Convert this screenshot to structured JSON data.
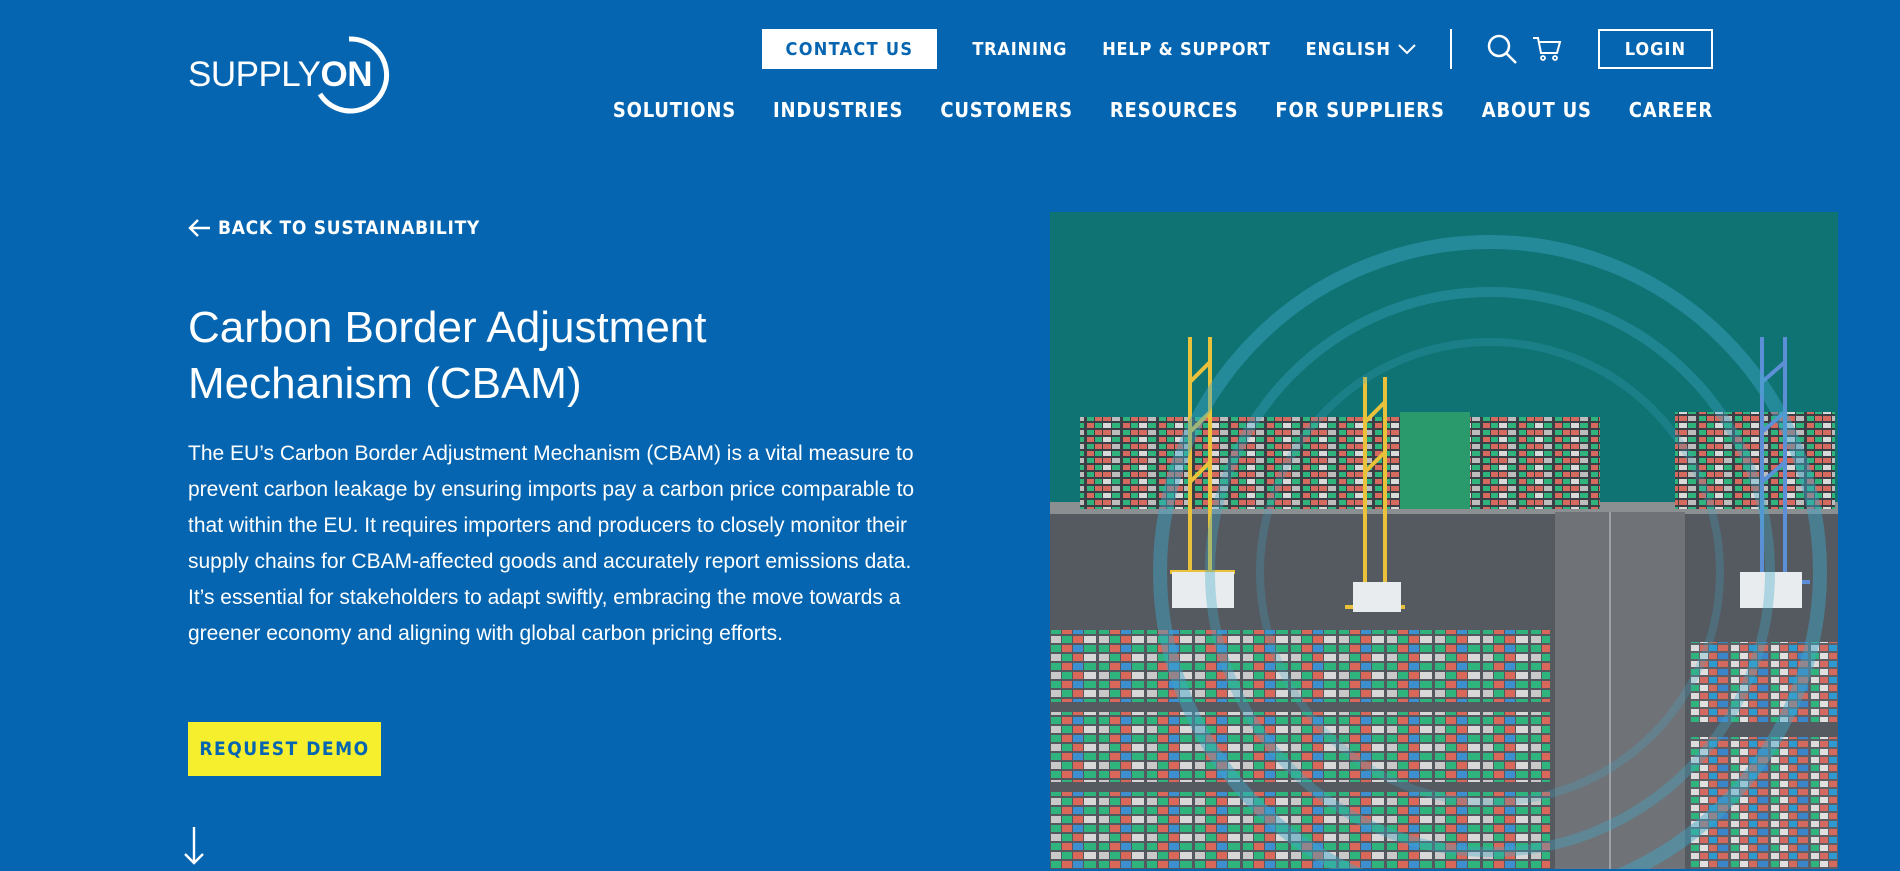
{
  "brand": {
    "logo_light": "SUPPLY",
    "logo_bold": "ON"
  },
  "topbar": {
    "contact": "CONTACT US",
    "training": "TRAINING",
    "help": "HELP & SUPPORT",
    "language": "ENGLISH",
    "login": "LOGIN"
  },
  "nav": {
    "items": [
      "SOLUTIONS",
      "INDUSTRIES",
      "CUSTOMERS",
      "RESOURCES",
      "FOR SUPPLIERS",
      "ABOUT US",
      "CAREER"
    ]
  },
  "content": {
    "back": "BACK TO SUSTAINABILITY",
    "title": "Carbon Border Adjustment Mechanism (CBAM)",
    "intro": "The EU’s Carbon Border Adjustment Mechanism (CBAM) is a vital measure to prevent carbon leakage by ensuring imports pay a carbon price comparable to that within the EU. It requires importers and producers to closely monitor their supply chains for CBAM-affected goods and accurately report emissions data. It’s essential for stakeholders to adapt swiftly, embracing the move towards a greener economy and aligning with global carbon pricing efforts.",
    "cta": "REQUEST DEMO"
  },
  "colors": {
    "background": "#0565b0",
    "cta": "#f5ef2e",
    "text": "#ffffff"
  },
  "icons": [
    "arrow-left-icon",
    "chevron-down-icon",
    "search-icon",
    "cart-icon",
    "arrow-down-icon"
  ]
}
